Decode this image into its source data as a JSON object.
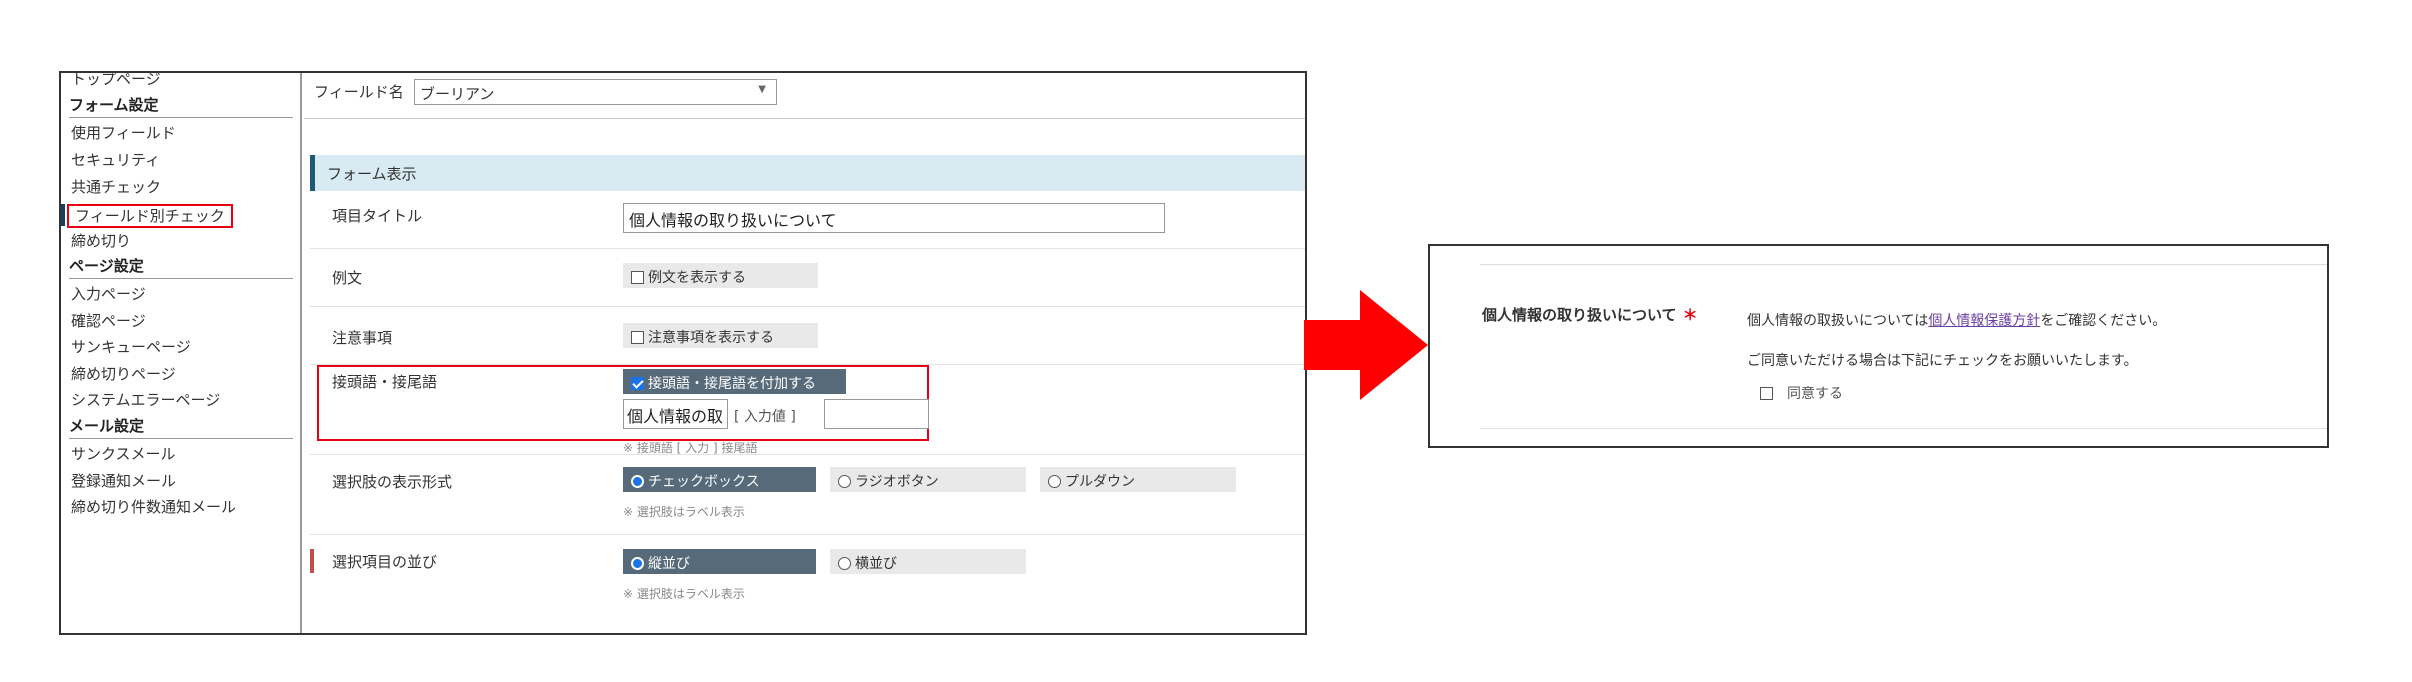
{
  "sidebar": {
    "top_item": "トップページ",
    "form_heading": "フォーム設定",
    "form_items": [
      "使用フィールド",
      "セキュリティ",
      "共通チェック",
      "フィールド別チェック",
      "締め切り"
    ],
    "page_heading": "ページ設定",
    "page_items": [
      "入力ページ",
      "確認ページ",
      "サンキューページ",
      "締め切りページ",
      "システムエラーページ"
    ],
    "mail_heading": "メール設定",
    "mail_items": [
      "サンクスメール",
      "登録通知メール",
      "締め切り件数通知メール"
    ],
    "active_item": "フィールド別チェック"
  },
  "field_name": {
    "label": "フィールド名",
    "value": "ブーリアン"
  },
  "section": {
    "title": "フォーム表示"
  },
  "form": {
    "title_label": "項目タイトル",
    "title_value": "個人情報の取り扱いについて",
    "example_label": "例文",
    "example_checkbox": "例文を表示する",
    "caution_label": "注意事項",
    "caution_checkbox": "注意事項を表示する",
    "affix_label": "接頭語・接尾語",
    "affix_checkbox": "接頭語・接尾語を付加する",
    "affix_prefix_value": "個人情報の取",
    "affix_middle": "[ 入力値 ]",
    "affix_suffix_value": "",
    "affix_note": "※ 接頭語 [ 入力 ] 接尾語",
    "display_label": "選択肢の表示形式",
    "display_options": [
      "チェックボックス",
      "ラジオボタン",
      "プルダウン"
    ],
    "display_note": "※ 選択肢はラベル表示",
    "order_label": "選択項目の並び",
    "order_options": [
      "縦並び",
      "横並び"
    ],
    "order_note": "※ 選択肢はラベル表示"
  },
  "preview": {
    "title": "個人情報の取り扱いについて",
    "required_mark": "＊",
    "line1_before": "個人情報の取扱いについては",
    "line1_link": "個人情報保護方針",
    "line1_after": "をご確認ください。",
    "line2": "ご同意いただける場合は下記にチェックをお願いいたします。",
    "checkbox_label": "同意する"
  },
  "colors": {
    "highlight_red": "#e60012",
    "arrow_red": "#ff0000",
    "section_bg": "#d9ebf2",
    "selected_chip": "#566a7a"
  }
}
